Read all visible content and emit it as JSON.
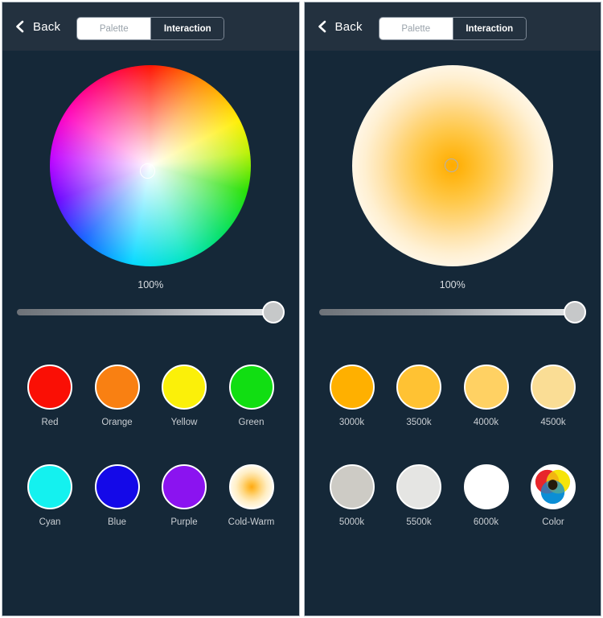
{
  "theme": {
    "header_bg": "#23313f",
    "body_bg": "#152838",
    "panel_border": "#b9c1c8",
    "label_color": "#c9ced3",
    "accent_white": "#ffffff"
  },
  "panels": [
    {
      "id": "palette-panel",
      "header": {
        "back_label": "Back",
        "back_icon": "chevron-left-icon",
        "tabs": [
          {
            "label": "Palette",
            "active": false
          },
          {
            "label": "Interaction",
            "active": true
          }
        ]
      },
      "picker": {
        "type": "color-wheel",
        "selector_icon": "selector-ring-icon"
      },
      "slider": {
        "value_label": "100%",
        "value": 100,
        "min": 0,
        "max": 100
      },
      "swatch_rows": [
        [
          {
            "label": "Red",
            "color": "#fa0f05"
          },
          {
            "label": "Orange",
            "color": "#f98012"
          },
          {
            "label": "Yellow",
            "color": "#fbf009"
          },
          {
            "label": "Green",
            "color": "#11de12"
          }
        ],
        [
          {
            "label": "Cyan",
            "color": "#14f1ef"
          },
          {
            "label": "Blue",
            "color": "#1409e8"
          },
          {
            "label": "Purple",
            "color": "#8b13f0"
          },
          {
            "label": "Cold-Warm",
            "color": "gradient-cold-warm"
          }
        ]
      ]
    },
    {
      "id": "interaction-panel",
      "header": {
        "back_label": "Back",
        "back_icon": "chevron-left-icon",
        "tabs": [
          {
            "label": "Palette",
            "active": false
          },
          {
            "label": "Interaction",
            "active": true
          }
        ]
      },
      "picker": {
        "type": "warm-white-gradient",
        "selector_icon": "selector-ring-icon"
      },
      "slider": {
        "value_label": "100%",
        "value": 100,
        "min": 0,
        "max": 100
      },
      "swatch_rows": [
        [
          {
            "label": "3000k",
            "color": "#ffb000"
          },
          {
            "label": "3500k",
            "color": "#ffc233"
          },
          {
            "label": "4000k",
            "color": "#ffd163"
          },
          {
            "label": "4500k",
            "color": "#fadd95"
          }
        ],
        [
          {
            "label": "5000k",
            "color": "#cdcbc5"
          },
          {
            "label": "5500k",
            "color": "#e5e5e3"
          },
          {
            "label": "6000k",
            "color": "#ffffff"
          },
          {
            "label": "Color",
            "color": "venn-rgb"
          }
        ]
      ]
    }
  ]
}
